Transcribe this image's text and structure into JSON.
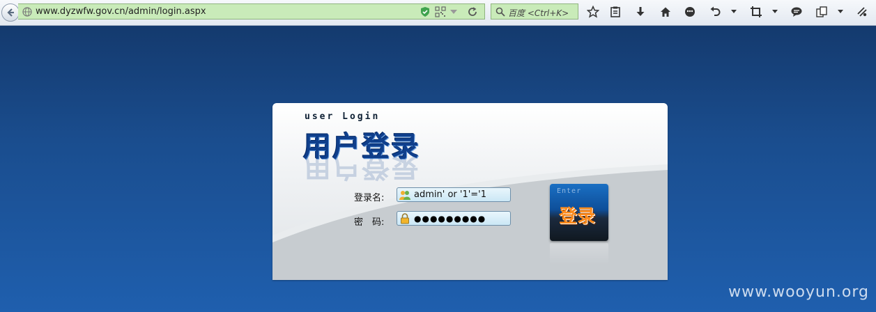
{
  "browser": {
    "url": "www.dyzwfw.gov.cn/admin/login.aspx",
    "search_placeholder": "百度 <Ctrl+K>",
    "icons": [
      "back-icon",
      "globe-icon",
      "shield-icon",
      "qr-code-icon",
      "dropdown-icon",
      "refresh-icon",
      "search-icon",
      "star-icon",
      "clipboard-icon",
      "download-icon",
      "home-icon",
      "chat-bubble-icon",
      "undo-icon",
      "crop-icon",
      "comment-icon",
      "copy-icon",
      "extension-icon"
    ]
  },
  "login": {
    "subtitle": "user Login",
    "title": "用户登录",
    "username_label": "登录名:",
    "username_value": "admin' or '1'='1",
    "password_label": "密　码:",
    "password_value": "●●●●●●●●●",
    "enter_label": "Enter",
    "enter_text": "登录"
  },
  "watermark": "www.wooyun.org"
}
